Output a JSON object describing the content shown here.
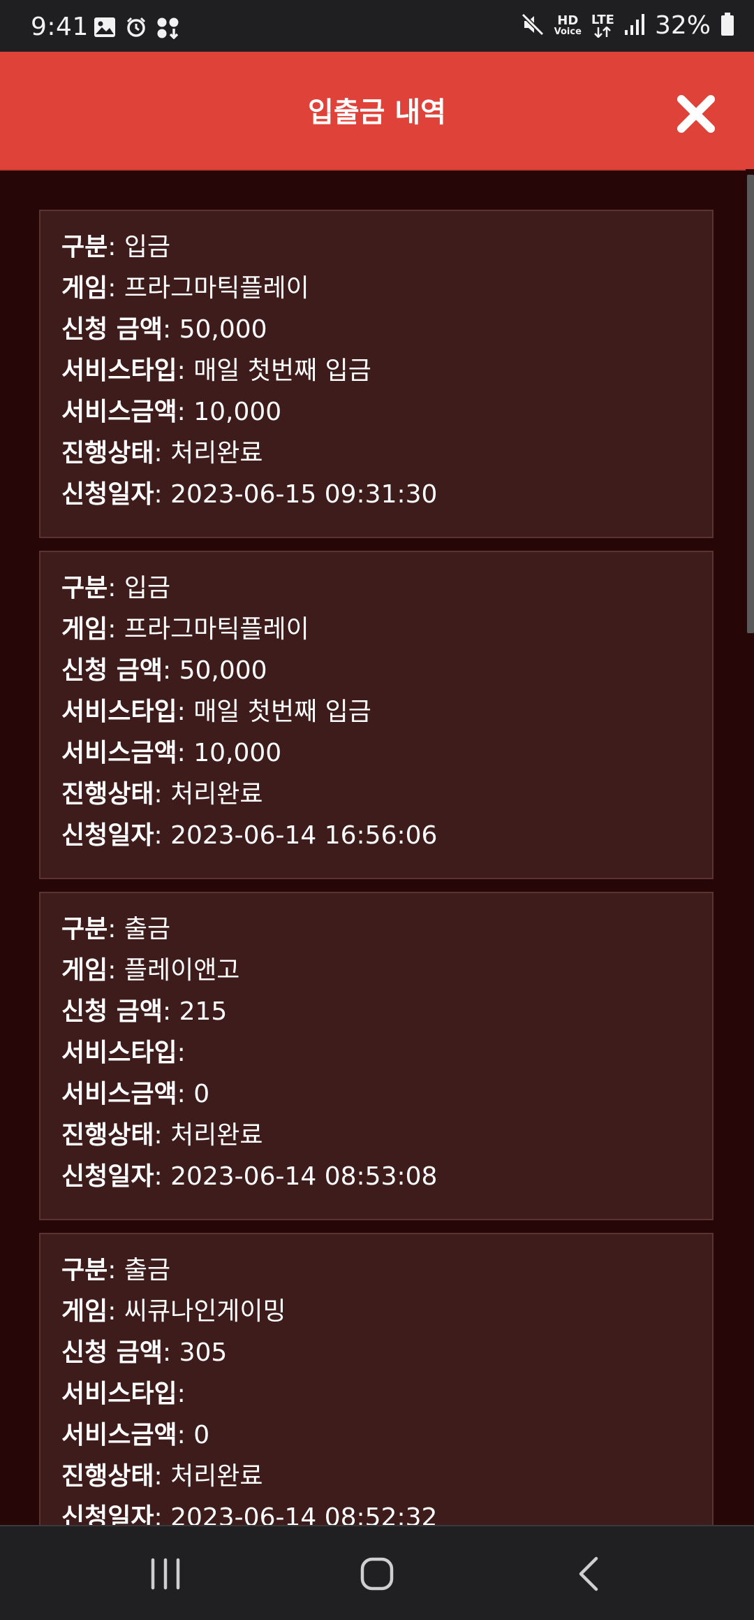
{
  "status_bar": {
    "time": "9:41",
    "battery_percent": "32%",
    "hd_label": "HD",
    "voice_label": "Voice",
    "lte_label": "LTE",
    "icons": [
      "gallery-icon",
      "alarm-icon",
      "app-update-icon",
      "mute-icon",
      "hd-voice-icon",
      "lte-icon",
      "signal-icon",
      "battery-icon"
    ]
  },
  "header": {
    "title": "입출금 내역",
    "background_color": "#df4238"
  },
  "labels": {
    "type": "구분",
    "game": "게임",
    "amount": "신청 금액",
    "service_type": "서비스타입",
    "service_amount": "서비스금액",
    "status": "진행상태",
    "date": "신청일자"
  },
  "records": [
    {
      "type": "입금",
      "game": "프라그마틱플레이",
      "amount": "50,000",
      "service_type": "매일 첫번째 입금",
      "service_amount": "10,000",
      "status": "처리완료",
      "date": "2023-06-15 09:31:30"
    },
    {
      "type": "입금",
      "game": "프라그마틱플레이",
      "amount": "50,000",
      "service_type": "매일 첫번째 입금",
      "service_amount": "10,000",
      "status": "처리완료",
      "date": "2023-06-14 16:56:06"
    },
    {
      "type": "출금",
      "game": "플레이앤고",
      "amount": "215",
      "service_type": "",
      "service_amount": "0",
      "status": "처리완료",
      "date": "2023-06-14 08:53:08"
    },
    {
      "type": "출금",
      "game": "씨큐나인게이밍",
      "amount": "305",
      "service_type": "",
      "service_amount": "0",
      "status": "처리완료",
      "date": "2023-06-14 08:52:32"
    }
  ],
  "nav_bar": {
    "buttons": [
      "recents-icon",
      "home-icon",
      "back-icon"
    ]
  }
}
